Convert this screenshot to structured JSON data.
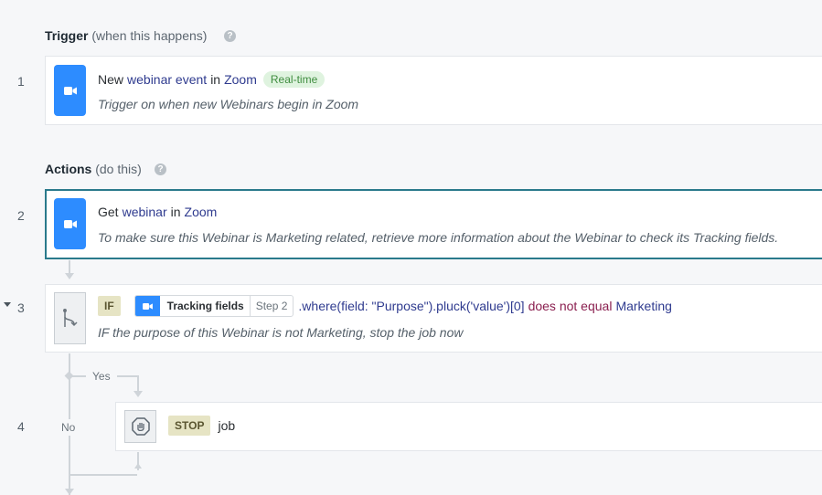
{
  "trigger_section": {
    "title": "Trigger",
    "subtitle": "(when this happens)",
    "help_icon": "question-circle-icon"
  },
  "actions_section": {
    "title": "Actions",
    "subtitle": "(do this)",
    "help_icon": "question-circle-icon"
  },
  "steps": [
    {
      "number": "1",
      "icon": "zoom-video-icon",
      "prefix": "New",
      "object": "webinar event",
      "connector": "in",
      "app": "Zoom",
      "badge": "Real-time",
      "description": "Trigger on when new Webinars begin in Zoom"
    },
    {
      "number": "2",
      "icon": "zoom-video-icon",
      "prefix": "Get",
      "object": "webinar",
      "connector": "in",
      "app": "Zoom",
      "description": "To make sure this Webinar is Marketing related, retrieve more information about the Webinar to check its Tracking fields."
    },
    {
      "number": "3",
      "collapse_icon": "caret-down-icon",
      "icon": "branch-if-icon",
      "tag": "IF",
      "pill_label": "Tracking fields",
      "pill_step": "Step 2",
      "expression": ".where(field: \"Purpose\").pluck('value')[0]",
      "operator": "does not equal",
      "value": "Marketing",
      "description": "IF the purpose of this Webinar is not Marketing, stop the job now"
    },
    {
      "number": "4",
      "icon": "stop-hand-icon",
      "tag": "STOP",
      "label": "job"
    }
  ],
  "branches": {
    "yes": "Yes",
    "no": "No"
  },
  "colors": {
    "zoom_blue": "#2d8cff",
    "selected_border": "#2a7a8c",
    "keyword": "#2f3b8f",
    "operator": "#8a1f4f"
  }
}
